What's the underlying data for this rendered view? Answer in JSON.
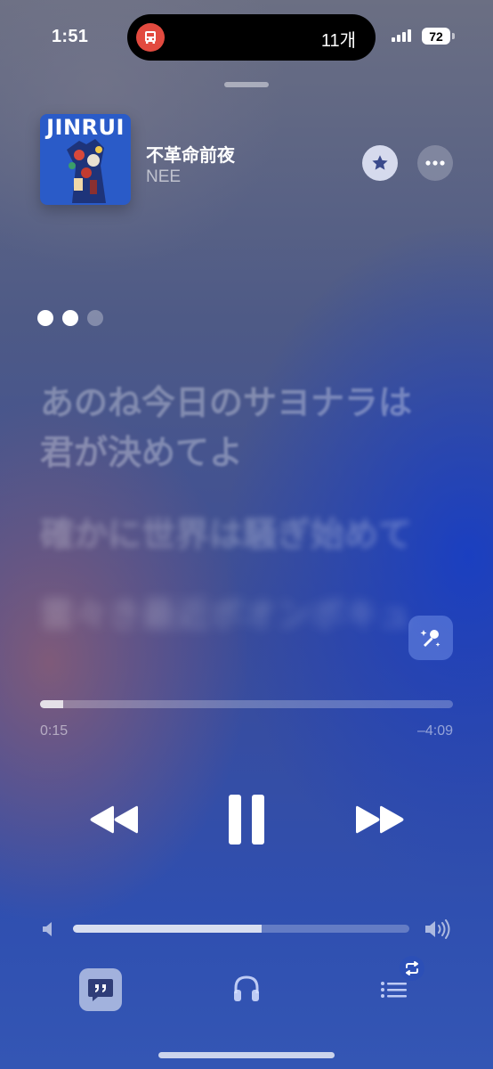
{
  "status_bar": {
    "time": "1:51",
    "island_text": "11개",
    "battery": "72",
    "island_icon": "bus-icon",
    "island_icon_color": "#e24a3f"
  },
  "now_playing": {
    "album_art_text": "JINRUI",
    "title": "不革命前夜",
    "artist": "NEE",
    "favorite_icon": "star-icon",
    "more_icon": "ellipsis-icon"
  },
  "lyrics": {
    "lines": [
      "あのね今日のサヨナラは",
      "君が決めてよ",
      "確かに世界は騒ぎ始めて",
      "雲々き最近ボオンボキュ"
    ]
  },
  "playback": {
    "elapsed": "0:15",
    "remaining": "–4:09",
    "progress": 0.056,
    "state": "playing"
  },
  "volume": {
    "level": 0.56
  },
  "bottom_bar": {
    "items": [
      "lyrics-icon",
      "airplay-headphones-icon",
      "queue-icon"
    ],
    "queue_badge": "repeat-icon"
  },
  "colors": {
    "accent": "#ffffff",
    "background_blue": "#2f4fb0"
  }
}
